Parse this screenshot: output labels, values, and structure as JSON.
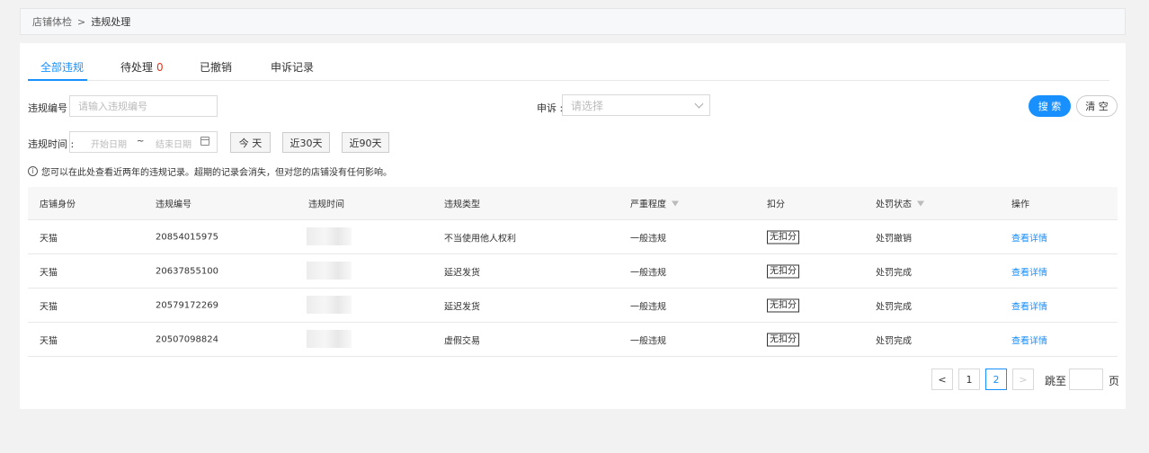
{
  "breadcrumb": {
    "parent": "店铺体检",
    "separator": ">",
    "current": "违规处理"
  },
  "tabs": [
    {
      "label": "全部违规",
      "count": ""
    },
    {
      "label": "待处理",
      "count": "0"
    },
    {
      "label": "已撤销",
      "count": ""
    },
    {
      "label": "申诉记录",
      "count": ""
    }
  ],
  "filters": {
    "violation_no_label": "违规编号 :",
    "violation_no_placeholder": "请输入违规编号",
    "appeal_label": "申诉 :",
    "appeal_placeholder": "请选择",
    "time_label": "违规时间 :",
    "start_placeholder": "开始日期",
    "range_sep": "~",
    "end_placeholder": "结束日期",
    "quick": [
      "今 天",
      "近30天",
      "近90天"
    ],
    "search_label": "搜 索",
    "clear_label": "清 空"
  },
  "notice": "您可以在此处查看近两年的违规记录。超期的记录会消失，但对您的店铺没有任何影响。",
  "table": {
    "headers": [
      "店铺身份",
      "违规编号",
      "违规时间",
      "违规类型",
      "严重程度",
      "扣分",
      "处罚状态",
      "操作"
    ],
    "rows": [
      {
        "identity": "天猫",
        "id": "20854015975",
        "time": "",
        "type": "不当使用他人权利",
        "severity": "一般违规",
        "points": "无扣分",
        "status": "处罚撤销",
        "action": "查看详情"
      },
      {
        "identity": "天猫",
        "id": "20637855100",
        "time": "",
        "type": "延迟发货",
        "severity": "一般违规",
        "points": "无扣分",
        "status": "处罚完成",
        "action": "查看详情"
      },
      {
        "identity": "天猫",
        "id": "20579172269",
        "time": "",
        "type": "延迟发货",
        "severity": "一般违规",
        "points": "无扣分",
        "status": "处罚完成",
        "action": "查看详情"
      },
      {
        "identity": "天猫",
        "id": "20507098824",
        "time": "",
        "type": "虚假交易",
        "severity": "一般违规",
        "points": "无扣分",
        "status": "处罚完成",
        "action": "查看详情"
      }
    ]
  },
  "pagination": {
    "prev": "<",
    "pages": [
      "1",
      "2"
    ],
    "current": "2",
    "next": ">",
    "jump_label": "跳至",
    "page_suffix": "页"
  }
}
